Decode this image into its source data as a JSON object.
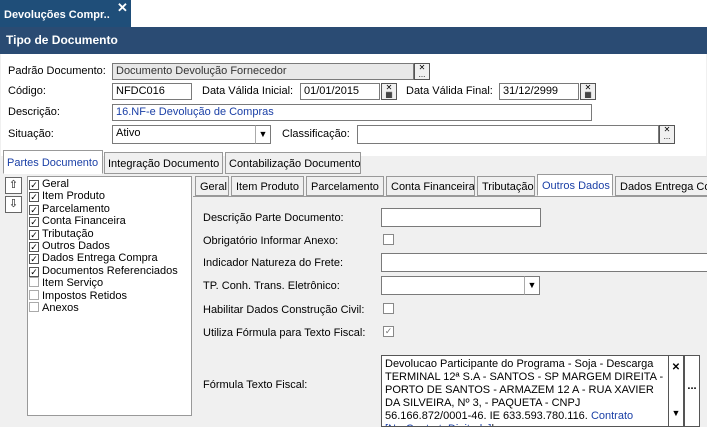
{
  "tab": {
    "title": "Devoluções Compr..",
    "close": "✕"
  },
  "header": {
    "title": "Tipo de Documento"
  },
  "form": {
    "padrao_label": "Padrão Documento:",
    "padrao_value": "Documento Devolução Fornecedor",
    "codigo_label": "Código:",
    "codigo_value": "NFDC016",
    "data_inicial_label": "Data Válida Inicial:",
    "data_inicial_value": "01/01/2015",
    "data_final_label": "Data Válida Final:",
    "data_final_value": "31/12/2999",
    "descricao_label": "Descrição:",
    "descricao_value": "16.NF-e Devolução de Compras",
    "situacao_label": "Situação:",
    "situacao_value": "Ativo",
    "classificacao_label": "Classificação:",
    "classificacao_value": "",
    "more_btn": "...",
    "clear_btn": "✕",
    "dropdown_arrow": "▼"
  },
  "main_tabs": [
    "Partes Documento",
    "Integração Documento",
    "Contabilização Documento"
  ],
  "nav": {
    "up": "⇧",
    "down": "⇩"
  },
  "tree": [
    {
      "label": "Geral",
      "checked": true
    },
    {
      "label": "Item Produto",
      "checked": true
    },
    {
      "label": "Parcelamento",
      "checked": true
    },
    {
      "label": "Conta Financeira",
      "checked": true
    },
    {
      "label": "Tributação",
      "checked": true
    },
    {
      "label": "Outros Dados",
      "checked": true
    },
    {
      "label": "Dados Entrega Compra",
      "checked": true
    },
    {
      "label": "Documentos Referenciados",
      "checked": true
    },
    {
      "label": "Item Serviço",
      "checked": false
    },
    {
      "label": "Impostos Retidos",
      "checked": false
    },
    {
      "label": "Anexos",
      "checked": false
    }
  ],
  "sub_tabs": [
    "Geral",
    "Item Produto",
    "Parcelamento",
    "Conta Financeira",
    "Tributação",
    "Outros Dados",
    "Dados Entrega Co"
  ],
  "outros": {
    "descricao_parte_label": "Descrição Parte Documento:",
    "descricao_parte_value": "",
    "obrigatorio_anexo_label": "Obrigatório Informar Anexo:",
    "obrigatorio_anexo_checked": false,
    "indicador_frete_label": "Indicador Natureza do Frete:",
    "indicador_frete_value": "",
    "tp_conh_label": "TP. Conh. Trans. Eletrônico:",
    "tp_conh_value": "",
    "habilitar_label": "Habilitar Dados Construção Civil:",
    "habilitar_checked": false,
    "utiliza_formula_label": "Utiliza Fórmula para Texto Fiscal:",
    "utiliza_formula_checked": true,
    "formula_label": "Fórmula Texto Fiscal:",
    "formula_text": "Devolucao Participante do Programa - Soja -  Descarga TERMINAL 12ª S.A - SANTOS - SP MARGEM DIREITA - PORTO DE SANTOS - ARMAZEM 12 A - RUA XAVIER DA SILVEIRA, Nº 3,  - PAQUETA - CNPJ 56.166.872/0001-46. IE 633.593.780.116.",
    "formula_token": "Contrato [NroContratoDigitado]",
    "check_mark": "✓"
  }
}
